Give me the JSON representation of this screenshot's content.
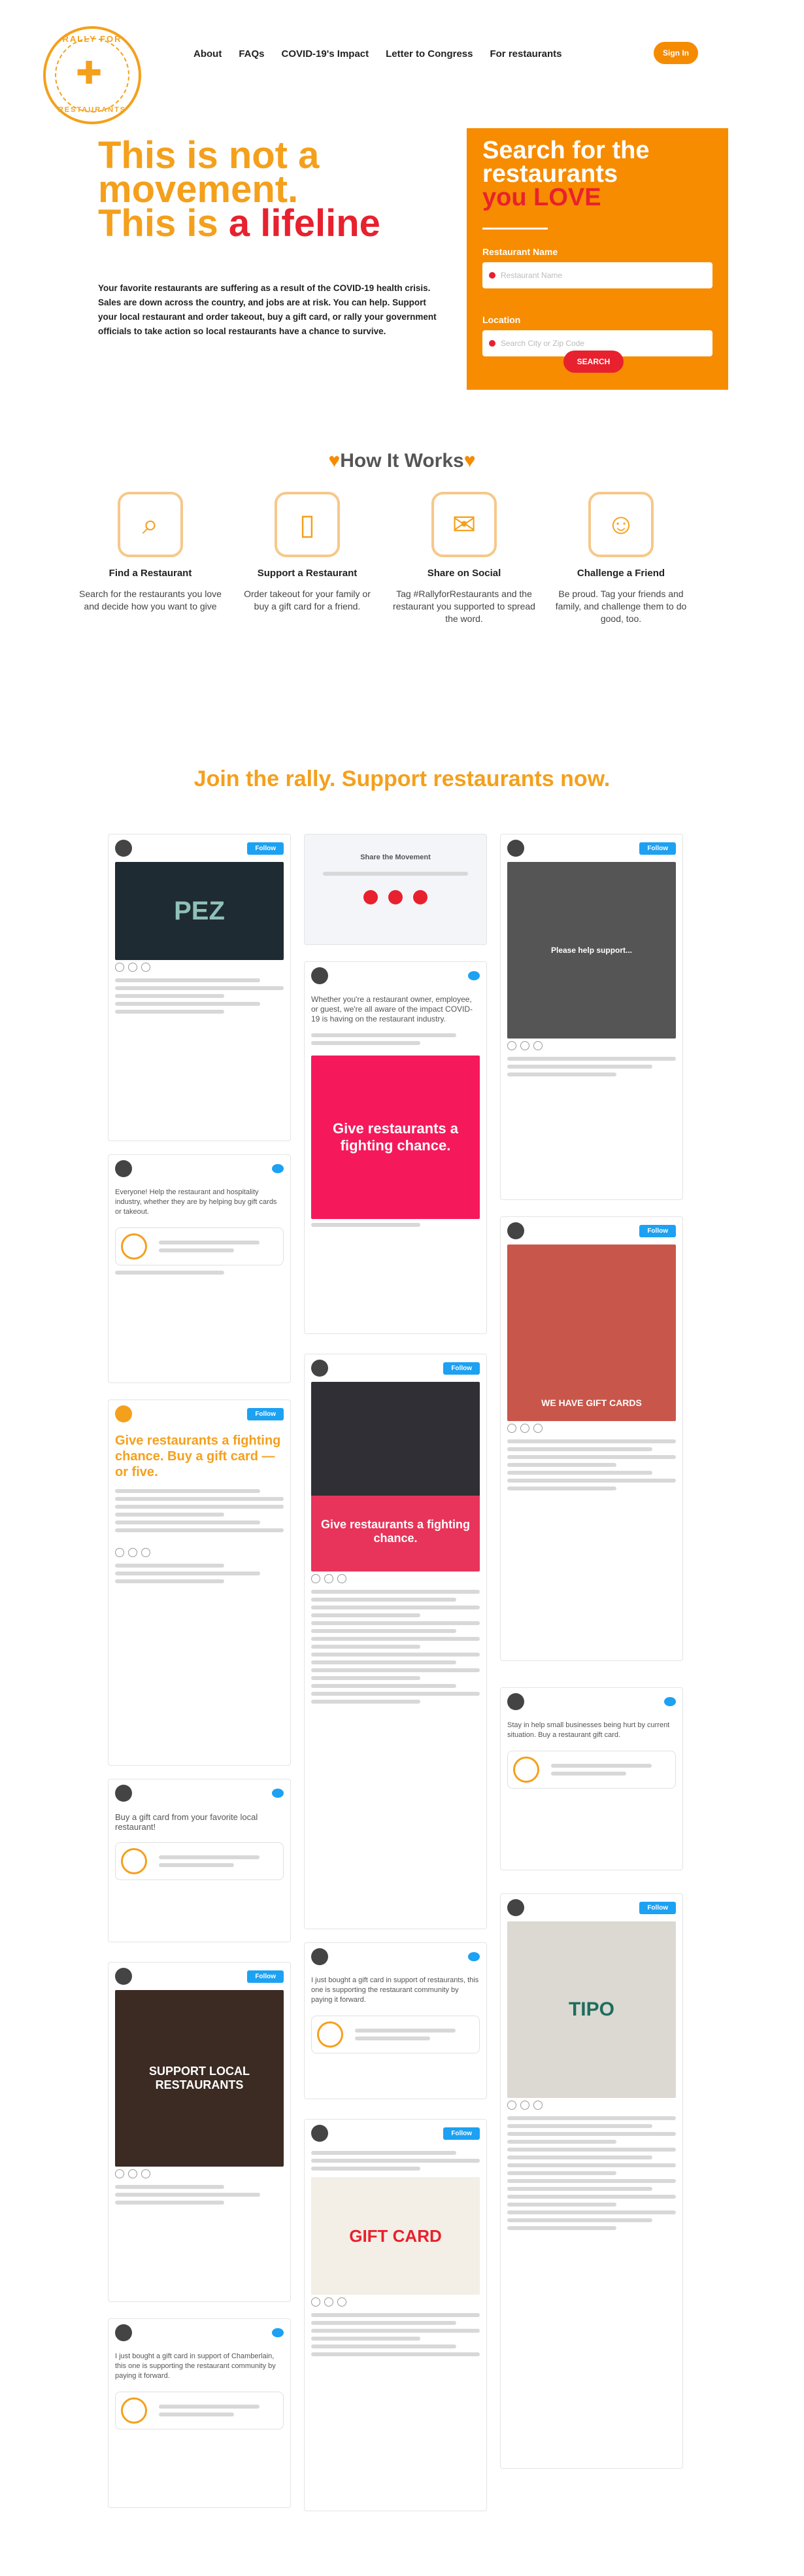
{
  "header": {
    "logo_top": "RALLY FOR",
    "logo_bottom": "RESTAURANTS",
    "nav": [
      "About",
      "FAQs",
      "COVID-19's Impact",
      "Letter to Congress",
      "For restaurants"
    ],
    "signup": "Sign In"
  },
  "hero": {
    "line1": "This is not a",
    "line2": "movement.",
    "line3_a": "This is ",
    "line3_b": "a lifeline",
    "description": "Your favorite restaurants are suffering as a result of the COVID-19 health crisis. Sales are down across the country, and jobs are at risk. You can help. Support your local restaurant and order takeout, buy a gift card, or rally your government officials to take action so local restaurants have a chance to survive."
  },
  "search": {
    "title1": "Search for the",
    "title2": "restaurants",
    "title3": "you LOVE",
    "name_label": "Restaurant Name",
    "name_placeholder": "Restaurant Name",
    "location_label": "Location",
    "location_placeholder": "Search City or Zip Code",
    "button": "SEARCH"
  },
  "how_it_works": {
    "title": "How It Works",
    "steps": [
      {
        "title": "Find a Restaurant",
        "desc": "Search for the restaurants you love and decide how you want to give"
      },
      {
        "title": "Support a Restaurant",
        "desc": "Order takeout for your family or buy a gift card for a friend."
      },
      {
        "title": "Share on Social",
        "desc": "Tag #RallyforRestaurants and the restaurant you supported to spread the word."
      },
      {
        "title": "Challenge a Friend",
        "desc": "Be proud. Tag your friends and family, and challenge them to do good, too."
      }
    ]
  },
  "join": "Join the rally. Support restaurants now.",
  "feed": {
    "follow": "Follow",
    "cards": [
      {
        "img": "PEZ"
      },
      {
        "tweet": "Everyone! Help the restaurant and hospitality industry, whether they are by helping buy gift cards or takeout."
      },
      {
        "headline": "Give restaurants a fighting chance. Buy a gift card — or five."
      },
      {
        "tweet": "Buy a gift card from your favorite local restaurant!"
      },
      {
        "img": "SUPPORT LOCAL RESTAURANTS"
      },
      {
        "tweet": "I just bought a gift card in support of Chamberlain, this one is supporting the restaurant community by paying it forward."
      },
      {
        "box_title": "Share the Movement"
      },
      {
        "tweet": "Whether you're a restaurant owner, employee, or guest, we're all aware of the impact COVID-19 is having on the restaurant industry."
      },
      {
        "img": "Give restaurants a fighting chance."
      },
      {
        "img": "Give restaurants a fighting chance."
      },
      {
        "tweet": "I just bought a gift card in support of restaurants, this one is supporting the restaurant community by paying it forward."
      },
      {
        "img": "GIFT CARD"
      },
      {
        "img": "Please help support..."
      },
      {
        "img": "WE HAVE GIFT CARDS"
      },
      {
        "tweet": "Stay in help small businesses being hurt by current situation. Buy a restaurant gift card."
      },
      {
        "img": "TIPO"
      }
    ]
  }
}
